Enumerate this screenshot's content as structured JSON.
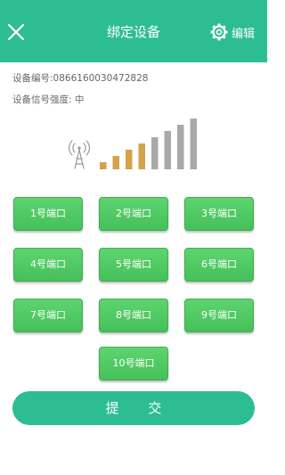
{
  "header": {
    "title": "绑定设备",
    "edit_label": "编辑"
  },
  "device": {
    "id_text": "设备编号:0866160030472828",
    "signal_text": "设备信号强度: 中",
    "signal_level": 0.5,
    "bars_total": 8,
    "bars_active": 4
  },
  "ports": [
    "1号端口",
    "2号端口",
    "3号端口",
    "4号端口",
    "5号端口",
    "6号端口",
    "7号端口",
    "8号端口",
    "9号端口",
    "10号端口"
  ],
  "submit_label": "提 交",
  "colors": {
    "primary": "#2dbd93",
    "port_button": "#4cc65f",
    "signal_active": "#d4a24a",
    "signal_inactive": "#a9a9a9"
  }
}
